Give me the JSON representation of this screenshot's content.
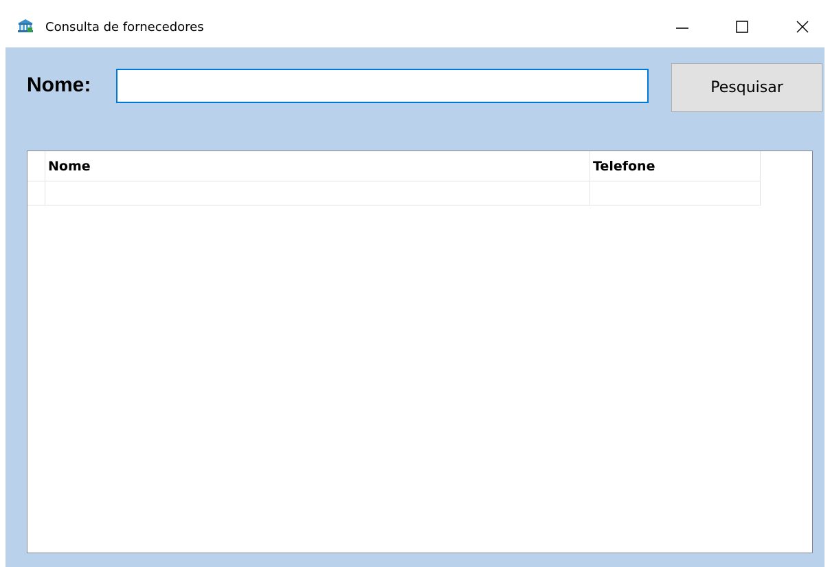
{
  "window": {
    "title": "Consulta de fornecedores",
    "icon": "building-icon",
    "controls": {
      "minimize": "minimize-icon",
      "maximize": "maximize-icon",
      "close": "close-icon"
    }
  },
  "search": {
    "label": "Nome:",
    "value": "",
    "button_label": "Pesquisar"
  },
  "grid": {
    "columns": [
      "Nome",
      "Telefone"
    ],
    "rows": [
      [
        "",
        ""
      ]
    ]
  },
  "colors": {
    "client_background": "#b9d1ea",
    "focus_border": "#0078d7",
    "button_face": "#e1e1e1",
    "grid_border": "#828790"
  }
}
